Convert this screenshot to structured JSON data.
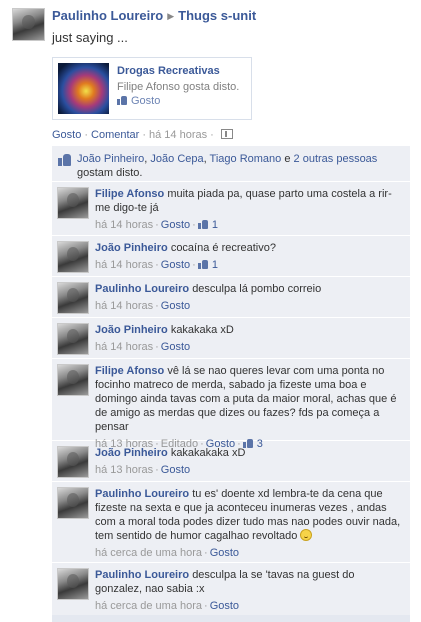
{
  "post": {
    "author": "Paulinho Loureiro",
    "target": "Thugs s-unit",
    "text": "just saying ...",
    "attachment": {
      "title": "Drogas Recreativas",
      "subtitle": "Filipe Afonso gosta disto.",
      "like_label": "Gosto"
    },
    "actions": {
      "like": "Gosto",
      "comment": "Comentar",
      "time": "há 14 horas"
    }
  },
  "likes": {
    "names": [
      "João Pinheiro",
      "João Cepa",
      "Tiago Romano"
    ],
    "sep1": ", ",
    "sep2": ", ",
    "and": " e ",
    "others": "2 outras pessoas",
    "suffix": " gostam disto."
  },
  "comments": [
    {
      "author": "Filipe Afonso",
      "text": "muita piada pa, quase parto uma costela a rir-me digo-te já",
      "time": "há 14 horas",
      "action": "Gosto",
      "likes": "1",
      "edited": ""
    },
    {
      "author": "João Pinheiro",
      "text": "cocaína é recreativo?",
      "time": "há 14 horas",
      "action": "Gosto",
      "likes": "1",
      "edited": ""
    },
    {
      "author": "Paulinho Loureiro",
      "text": "desculpa lá pombo correio",
      "time": "há 14 horas",
      "action": "Gosto",
      "likes": "",
      "edited": ""
    },
    {
      "author": "João Pinheiro",
      "text": "kakakaka xD",
      "time": "há 14 horas",
      "action": "Gosto",
      "likes": "",
      "edited": ""
    },
    {
      "author": "Filipe Afonso",
      "text": "vê lá se nao queres levar com uma ponta no focinho matreco de merda, sabado ja fizeste uma boa e domingo ainda tavas com a puta da maior moral, achas que é de amigo as merdas que dizes ou fazes? fds pa começa a pensar",
      "time": "há 13 horas",
      "action": "Gosto",
      "likes": "3",
      "edited": "Editado"
    },
    {
      "author": "João Pinheiro",
      "text": "kakakakaka xD",
      "time": "há 13 horas",
      "action": "Gosto",
      "likes": "",
      "edited": ""
    },
    {
      "author": "Paulinho Loureiro",
      "text": "tu es' doente xd lembra-te da cena que fizeste na sexta e que ja aconteceu inumeras vezes , andas com a moral toda podes dizer tudo mas nao podes ouvir nada, tem sentido de humor cagalhao revoltado",
      "time": "há cerca de uma hora",
      "action": "Gosto",
      "likes": "",
      "edited": ""
    },
    {
      "author": "Paulinho Loureiro",
      "text": "desculpa la se 'tavas na guest do gonzalez, nao sabia :x",
      "time": "há cerca de uma hora",
      "action": "Gosto",
      "likes": "",
      "edited": ""
    }
  ],
  "colors": {
    "link": "#3b5998",
    "feedback_bg": "#edeff4",
    "meta": "#999999"
  },
  "icons": [
    "thumbs-up-icon",
    "comment-icon",
    "smiley-icon",
    "arrow-right-icon"
  ]
}
